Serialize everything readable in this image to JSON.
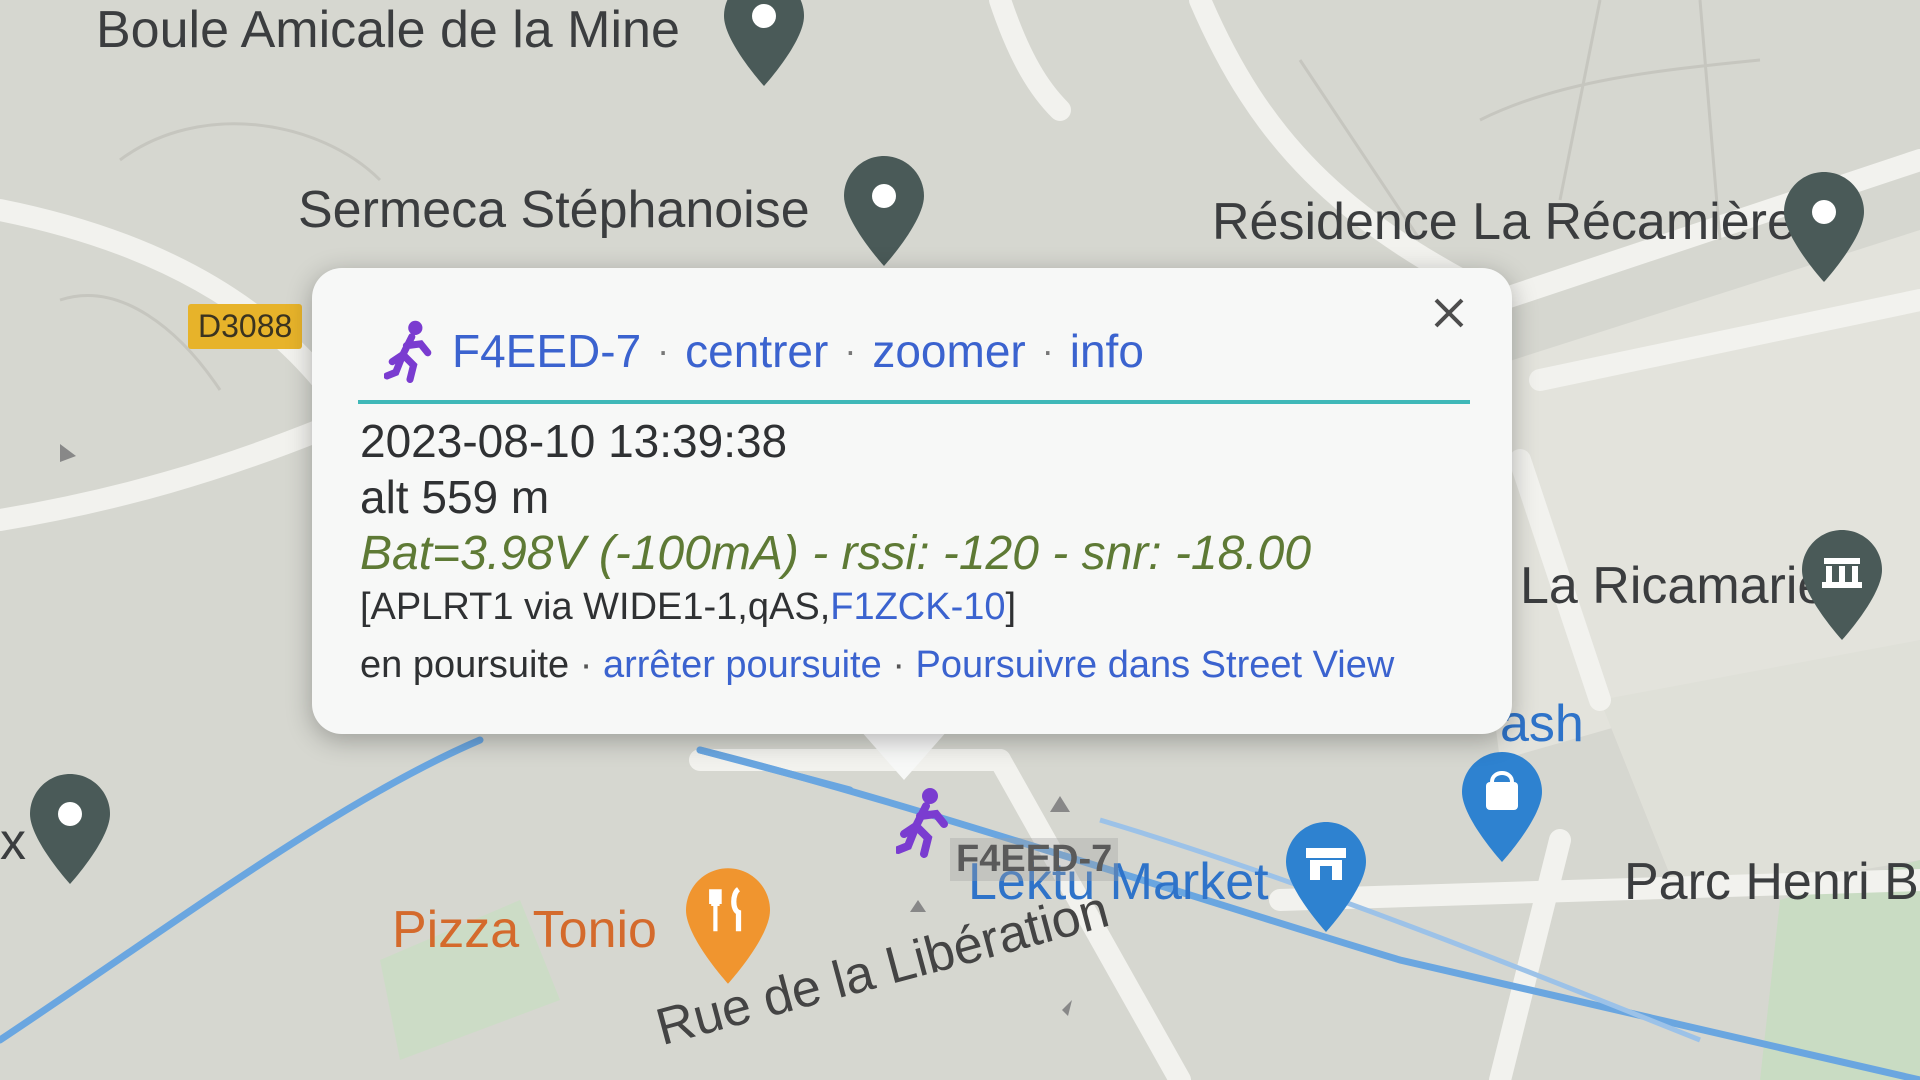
{
  "map": {
    "pois": [
      {
        "id": "boule",
        "label": "Boule Amicale de la Mine"
      },
      {
        "id": "sermeca",
        "label": "Sermeca Stéphanoise"
      },
      {
        "id": "residence",
        "label": "Résidence La Récamière"
      },
      {
        "id": "ricamarie",
        "label": "La Ricamarie"
      },
      {
        "id": "wash",
        "label": "ash"
      },
      {
        "id": "lektu",
        "label": "Lektu Market"
      },
      {
        "id": "pizza",
        "label": "Pizza Tonio"
      },
      {
        "id": "parc",
        "label": "Parc Henri Ba"
      },
      {
        "id": "x",
        "label": "x"
      }
    ],
    "road_badge": "D3088",
    "street_label": "Rue de la Libération",
    "station_marker_label": "F4EED-7",
    "colors": {
      "pin_gray": "#4a5a58",
      "pin_orange": "#f0952f",
      "pin_blue": "#2e82d0",
      "accent_teal": "#3fb8b8",
      "link_blue": "#3b63cf",
      "runner_purple": "#7a3cd0"
    }
  },
  "popup": {
    "icon": "runner-icon",
    "callsign": "F4EED-7",
    "links": [
      "centrer",
      "zoomer",
      "info"
    ],
    "separator": "·",
    "timestamp": "2023-08-10 13:39:38",
    "altitude": "alt 559 m",
    "comment": "Bat=3.98V (-100mA) - rssi: -120 - snr: -18.00",
    "path_prefix": "[APLRT1 via WIDE1-1,qAS,",
    "path_igate": "F1ZCK-10",
    "path_suffix": "]",
    "tracking_status": "en poursuite",
    "stop_tracking": "arrêter poursuite",
    "street_view": "Poursuivre dans Street View",
    "close_icon": "close-icon"
  }
}
